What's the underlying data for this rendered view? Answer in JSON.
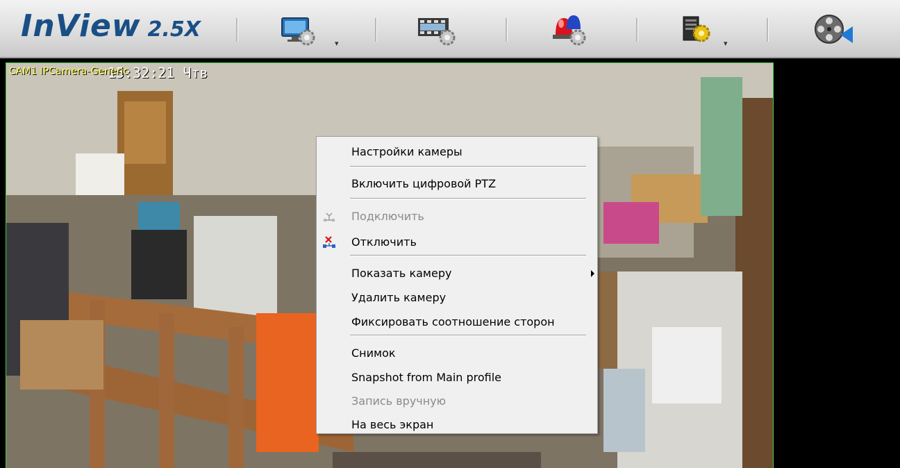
{
  "app": {
    "name": "InView",
    "version": "2.5X"
  },
  "toolbar": {
    "buttons": [
      {
        "icon": "monitor-settings-icon",
        "has_dropdown": true,
        "dropdown_glyph": "▾"
      },
      {
        "icon": "video-settings-icon",
        "has_dropdown": false
      },
      {
        "icon": "alarm-settings-icon",
        "has_dropdown": false
      },
      {
        "icon": "server-settings-icon",
        "has_dropdown": true,
        "dropdown_glyph": "▾"
      },
      {
        "icon": "playback-reel-icon",
        "has_dropdown": false
      }
    ]
  },
  "video": {
    "camera_label": "CAM1 IPCamera-Generic",
    "time_overlay": "15:32:21 Чтв",
    "border_color": "#46d046"
  },
  "context_menu": {
    "items": [
      {
        "label": "Настройки камеры",
        "enabled": true
      },
      {
        "label": "Включить цифровой PTZ",
        "enabled": true
      },
      {
        "label": "Подключить",
        "enabled": false,
        "icon": "connect-icon"
      },
      {
        "label": "Отключить",
        "enabled": true,
        "icon": "disconnect-icon"
      },
      {
        "label": "Показать камеру",
        "enabled": true,
        "submenu": true
      },
      {
        "label": "Удалить камеру",
        "enabled": true
      },
      {
        "label": "Фиксировать соотношение сторон",
        "enabled": true
      },
      {
        "label": "Снимок",
        "enabled": true
      },
      {
        "label": "Snapshot from Main profile",
        "enabled": true
      },
      {
        "label": "Запись вручную",
        "enabled": false
      },
      {
        "label": "На весь экран",
        "enabled": true
      }
    ]
  }
}
